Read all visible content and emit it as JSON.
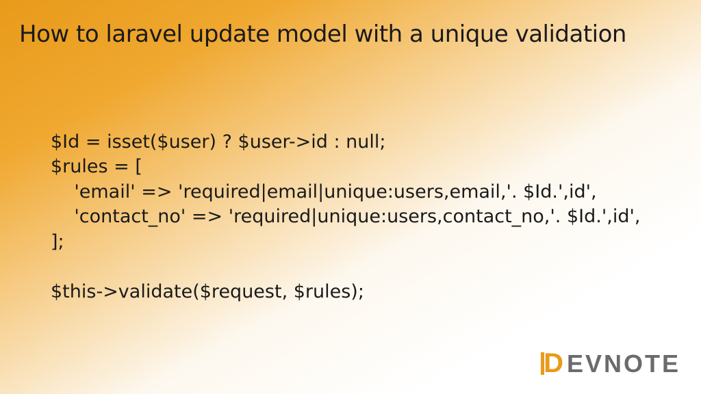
{
  "title": "How to laravel update model with a unique validation",
  "code": {
    "line1": "$Id = isset($user) ? $user->id : null;",
    "line2": "$rules = [",
    "line3": "    'email' => 'required|email|unique:users,email,'. $Id.',id',",
    "line4": "    'contact_no' => 'required|unique:users,contact_no,'. $Id.',id',",
    "line5": "];",
    "line6": "",
    "line7": "$this->validate($request, $rules);"
  },
  "logo": {
    "letter": "D",
    "rest": "EVNOTE"
  }
}
